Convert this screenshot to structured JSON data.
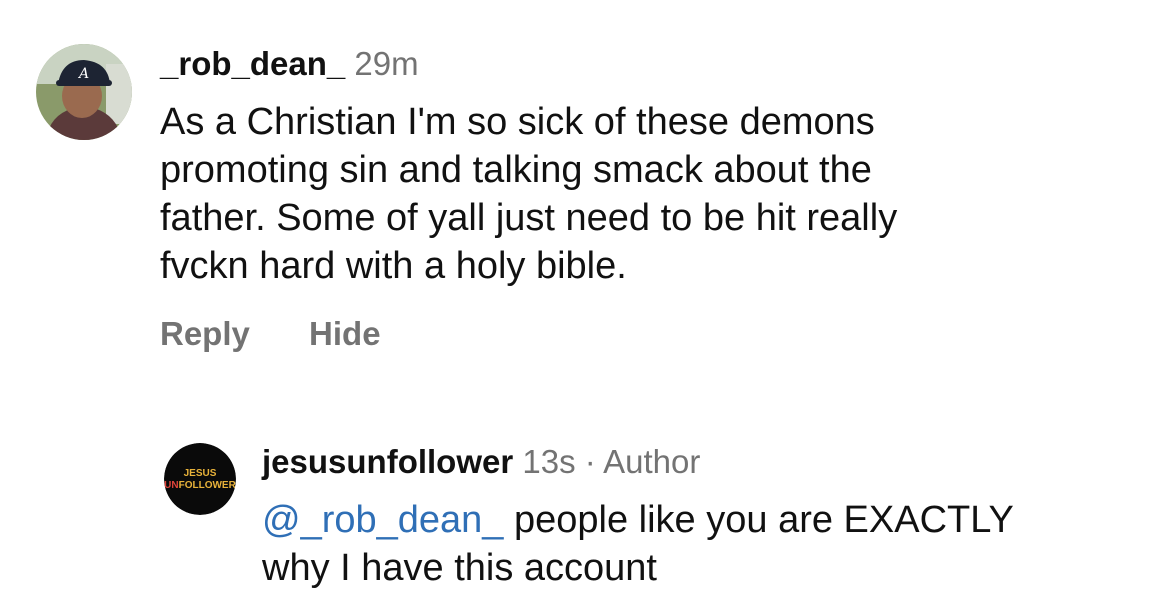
{
  "comment1": {
    "username": "_rob_dean_",
    "time": "29m",
    "text_lines": [
      "As a Christian I'm so sick of these demons",
      "promoting sin and talking smack about the",
      "father. Some of yall just need to be hit really",
      "fvckn hard with a holy bible."
    ],
    "actions": {
      "reply": "Reply",
      "hide": "Hide"
    },
    "avatar": {
      "cap_logo": "A"
    }
  },
  "comment2": {
    "username": "jesusunfollower",
    "time": "13s",
    "separator": "·",
    "role": "Author",
    "mention": "@_rob_dean_",
    "text_line1_rest": " people like you are EXACTLY",
    "text_line2": "why I have this account",
    "avatar": {
      "logo_line1": "JESUS",
      "logo_line2_prefix": "UN",
      "logo_line2_rest": "FOLLOWER"
    }
  },
  "colors": {
    "mention": "#2f6fb6",
    "secondary_text": "#737373",
    "logo_gold": "#e8b23a"
  }
}
